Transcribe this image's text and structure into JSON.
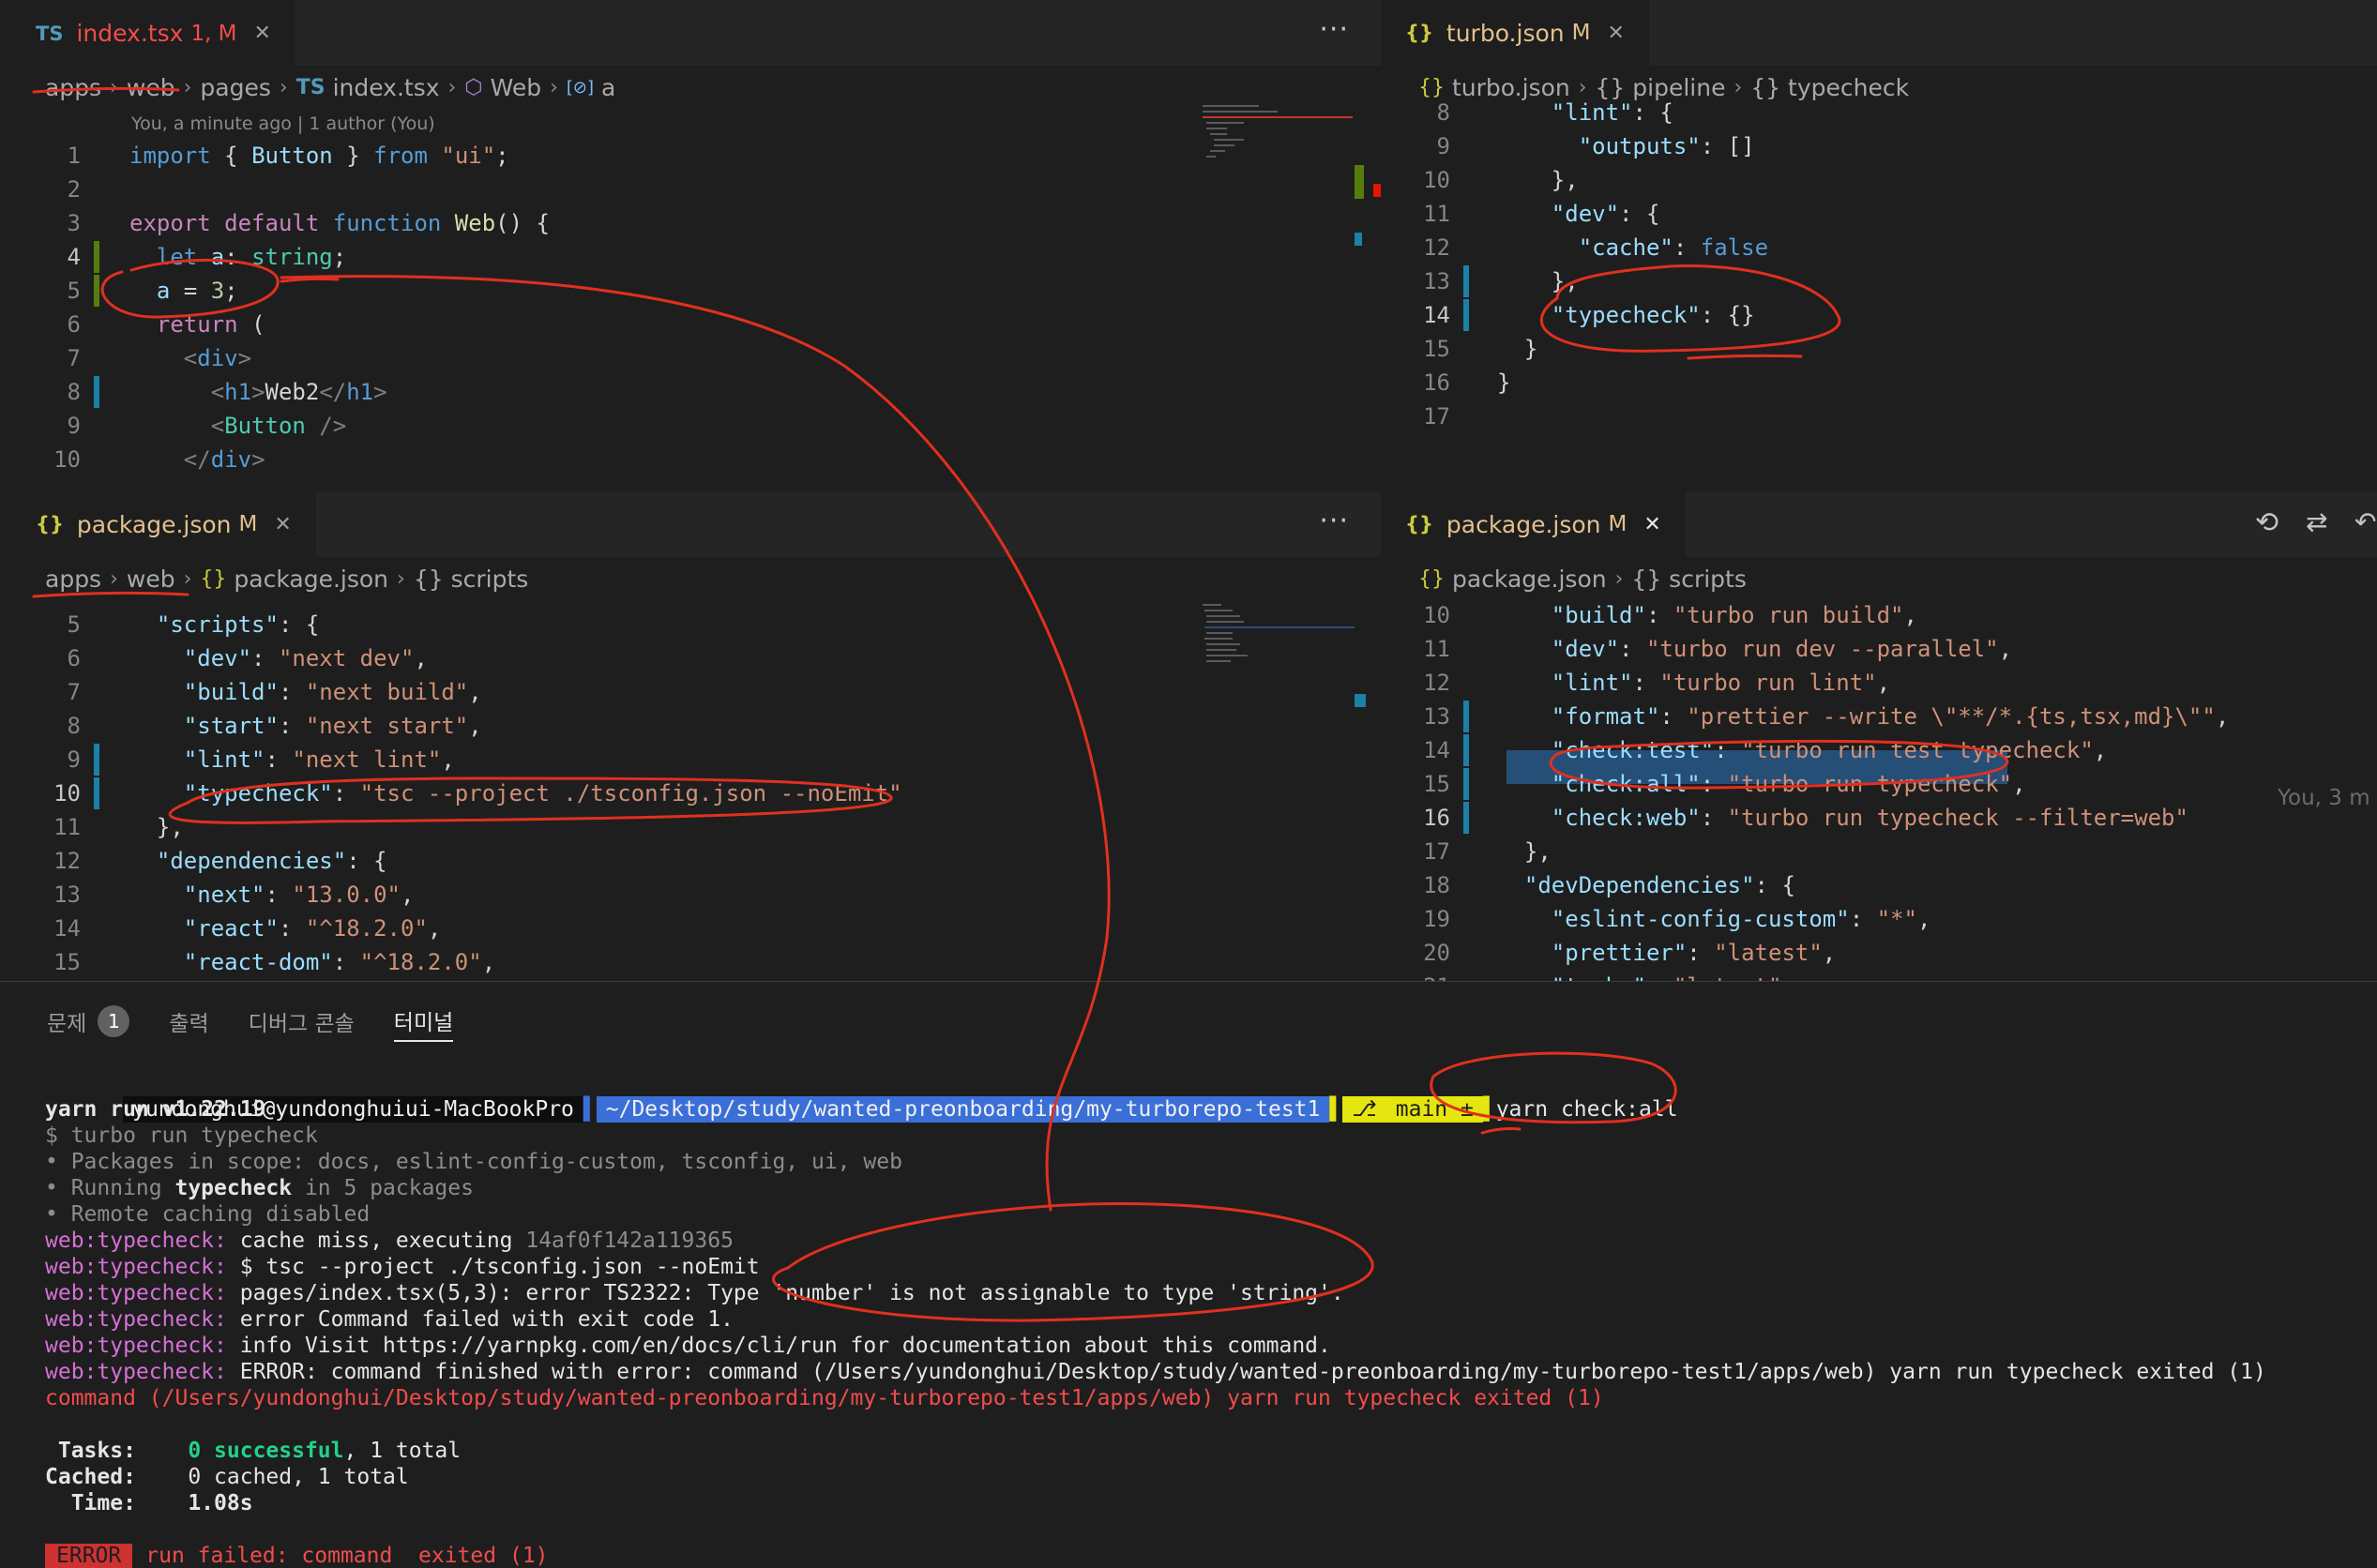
{
  "pane_tl": {
    "tab": {
      "icon": "TS",
      "name": "index.tsx",
      "status": "1, M",
      "close": "✕"
    },
    "more": "···",
    "breadcrumb": [
      "apps",
      "web",
      "pages",
      "index.tsx",
      "Web",
      "a"
    ],
    "breadcrumb_icons": {
      "file": "TS",
      "func": "⬡",
      "var": "[⊘]"
    },
    "blame": "You, a minute ago | 1 author (You)",
    "lines": [
      {
        "n": "1",
        "t": [
          [
            "kb",
            "import "
          ],
          [
            "w",
            "{ "
          ],
          [
            "p",
            "Button"
          ],
          [
            "w",
            " } "
          ],
          [
            "kb",
            "from "
          ],
          [
            "s",
            "\"ui\""
          ],
          [
            "w",
            ";"
          ]
        ]
      },
      {
        "n": "2",
        "t": []
      },
      {
        "n": "3",
        "t": [
          [
            "k",
            "export "
          ],
          [
            "k",
            "default "
          ],
          [
            "kb",
            "function "
          ],
          [
            "f",
            "Web"
          ],
          [
            "w",
            "() {"
          ]
        ]
      },
      {
        "n": "4",
        "t": [
          [
            "w",
            "  "
          ],
          [
            "kb",
            "let "
          ],
          [
            "p",
            "a"
          ],
          [
            "w",
            ": "
          ],
          [
            "ty",
            "string"
          ],
          [
            "w",
            ";"
          ]
        ]
      },
      {
        "n": "5",
        "t": [
          [
            "w",
            "  "
          ],
          [
            "p",
            "a"
          ],
          [
            "w",
            " = "
          ],
          [
            "n",
            "3"
          ],
          [
            "w",
            ";"
          ]
        ]
      },
      {
        "n": "6",
        "t": [
          [
            "w",
            "  "
          ],
          [
            "k",
            "return "
          ],
          [
            "w",
            "("
          ]
        ]
      },
      {
        "n": "7",
        "t": [
          [
            "w",
            "    "
          ],
          [
            "g",
            "<"
          ],
          [
            "kb",
            "div"
          ],
          [
            "g",
            ">"
          ]
        ]
      },
      {
        "n": "8",
        "t": [
          [
            "w",
            "      "
          ],
          [
            "g",
            "<"
          ],
          [
            "kb",
            "h1"
          ],
          [
            "g",
            ">"
          ],
          [
            "w",
            "Web2"
          ],
          [
            "g",
            "</"
          ],
          [
            "kb",
            "h1"
          ],
          [
            "g",
            ">"
          ]
        ]
      },
      {
        "n": "9",
        "t": [
          [
            "w",
            "      "
          ],
          [
            "g",
            "<"
          ],
          [
            "t",
            "Button"
          ],
          [
            "w",
            " "
          ],
          [
            "g",
            "/>"
          ]
        ]
      },
      {
        "n": "10",
        "t": [
          [
            "w",
            "    "
          ],
          [
            "g",
            "</"
          ],
          [
            "kb",
            "div"
          ],
          [
            "g",
            ">"
          ]
        ]
      }
    ]
  },
  "pane_tr": {
    "tab": {
      "icon": "{}",
      "name": "turbo.json",
      "status": "M",
      "close": "✕"
    },
    "breadcrumb": [
      "turbo.json",
      "{} pipeline",
      "{} typecheck"
    ],
    "lines": [
      {
        "n": "8",
        "t": [
          [
            "w",
            "    "
          ],
          [
            "p",
            "\"lint\""
          ],
          [
            "w",
            ": {"
          ]
        ]
      },
      {
        "n": "9",
        "t": [
          [
            "w",
            "      "
          ],
          [
            "p",
            "\"outputs\""
          ],
          [
            "w",
            ": []"
          ]
        ]
      },
      {
        "n": "10",
        "t": [
          [
            "w",
            "    },"
          ]
        ]
      },
      {
        "n": "11",
        "t": [
          [
            "w",
            "    "
          ],
          [
            "p",
            "\"dev\""
          ],
          [
            "w",
            ": {"
          ]
        ]
      },
      {
        "n": "12",
        "t": [
          [
            "w",
            "      "
          ],
          [
            "p",
            "\"cache\""
          ],
          [
            "w",
            ": "
          ],
          [
            "kb",
            "false"
          ]
        ]
      },
      {
        "n": "13",
        "t": [
          [
            "w",
            "    },"
          ]
        ]
      },
      {
        "n": "14",
        "t": [
          [
            "w",
            "    "
          ],
          [
            "p",
            "\"typecheck\""
          ],
          [
            "w",
            ": {}"
          ]
        ]
      },
      {
        "n": "15",
        "t": [
          [
            "w",
            "  }"
          ]
        ]
      },
      {
        "n": "16",
        "t": [
          [
            "w",
            "}"
          ]
        ]
      },
      {
        "n": "17",
        "t": []
      }
    ]
  },
  "pane_ml": {
    "tab": {
      "icon": "{}",
      "name": "package.json",
      "status": "M",
      "close": "✕"
    },
    "more": "···",
    "breadcrumb": [
      "apps",
      "web",
      "package.json",
      "{} scripts"
    ],
    "lines": [
      {
        "n": "5",
        "t": [
          [
            "w",
            "  "
          ],
          [
            "p",
            "\"scripts\""
          ],
          [
            "w",
            ": {"
          ]
        ]
      },
      {
        "n": "6",
        "t": [
          [
            "w",
            "    "
          ],
          [
            "p",
            "\"dev\""
          ],
          [
            "w",
            ": "
          ],
          [
            "s",
            "\"next dev\""
          ],
          [
            "w",
            ","
          ]
        ]
      },
      {
        "n": "7",
        "t": [
          [
            "w",
            "    "
          ],
          [
            "p",
            "\"build\""
          ],
          [
            "w",
            ": "
          ],
          [
            "s",
            "\"next build\""
          ],
          [
            "w",
            ","
          ]
        ]
      },
      {
        "n": "8",
        "t": [
          [
            "w",
            "    "
          ],
          [
            "p",
            "\"start\""
          ],
          [
            "w",
            ": "
          ],
          [
            "s",
            "\"next start\""
          ],
          [
            "w",
            ","
          ]
        ]
      },
      {
        "n": "9",
        "t": [
          [
            "w",
            "    "
          ],
          [
            "p",
            "\"lint\""
          ],
          [
            "w",
            ": "
          ],
          [
            "s",
            "\"next lint\""
          ],
          [
            "w",
            ","
          ]
        ]
      },
      {
        "n": "10",
        "t": [
          [
            "w",
            "    "
          ],
          [
            "p",
            "\"typecheck\""
          ],
          [
            "w",
            ": "
          ],
          [
            "s",
            "\"tsc --project ./tsconfig.json --noEmit\""
          ]
        ]
      },
      {
        "n": "11",
        "t": [
          [
            "w",
            "  },"
          ]
        ]
      },
      {
        "n": "12",
        "t": [
          [
            "w",
            "  "
          ],
          [
            "p",
            "\"dependencies\""
          ],
          [
            "w",
            ": {"
          ]
        ]
      },
      {
        "n": "13",
        "t": [
          [
            "w",
            "    "
          ],
          [
            "p",
            "\"next\""
          ],
          [
            "w",
            ": "
          ],
          [
            "s",
            "\"13.0.0\""
          ],
          [
            "w",
            ","
          ]
        ]
      },
      {
        "n": "14",
        "t": [
          [
            "w",
            "    "
          ],
          [
            "p",
            "\"react\""
          ],
          [
            "w",
            ": "
          ],
          [
            "s",
            "\"^18.2.0\""
          ],
          [
            "w",
            ","
          ]
        ]
      },
      {
        "n": "15",
        "t": [
          [
            "w",
            "    "
          ],
          [
            "p",
            "\"react-dom\""
          ],
          [
            "w",
            ": "
          ],
          [
            "s",
            "\"^18.2.0\""
          ],
          [
            "w",
            ","
          ]
        ]
      }
    ]
  },
  "pane_mr": {
    "tab": {
      "icon": "{}",
      "name": "package.json",
      "status": "M",
      "close": "✕"
    },
    "breadcrumb": [
      "package.json",
      "{} scripts"
    ],
    "blame_inline": "You, 3 m",
    "lines": [
      {
        "n": "10",
        "t": [
          [
            "w",
            "    "
          ],
          [
            "p",
            "\"build\""
          ],
          [
            "w",
            ": "
          ],
          [
            "s",
            "\"turbo run build\""
          ],
          [
            "w",
            ","
          ]
        ]
      },
      {
        "n": "11",
        "t": [
          [
            "w",
            "    "
          ],
          [
            "p",
            "\"dev\""
          ],
          [
            "w",
            ": "
          ],
          [
            "s",
            "\"turbo run dev --parallel\""
          ],
          [
            "w",
            ","
          ]
        ]
      },
      {
        "n": "12",
        "t": [
          [
            "w",
            "    "
          ],
          [
            "p",
            "\"lint\""
          ],
          [
            "w",
            ": "
          ],
          [
            "s",
            "\"turbo run lint\""
          ],
          [
            "w",
            ","
          ]
        ]
      },
      {
        "n": "13",
        "t": [
          [
            "w",
            "    "
          ],
          [
            "p",
            "\"format\""
          ],
          [
            "w",
            ": "
          ],
          [
            "s",
            "\"prettier --write \\\"**/*.{ts,tsx,md}\\\"\""
          ],
          [
            "w",
            ","
          ]
        ]
      },
      {
        "n": "14",
        "t": [
          [
            "w",
            "    "
          ],
          [
            "p",
            "\"check:test\""
          ],
          [
            "w",
            ": "
          ],
          [
            "s",
            "\"turbo run test typecheck\""
          ],
          [
            "w",
            ","
          ]
        ]
      },
      {
        "n": "15",
        "t": [
          [
            "w",
            "    "
          ],
          [
            "p",
            "\"check:all\""
          ],
          [
            "w",
            ": "
          ],
          [
            "s",
            "\"turbo run typecheck\""
          ],
          [
            "w",
            ","
          ]
        ]
      },
      {
        "n": "16",
        "t": [
          [
            "w",
            "    "
          ],
          [
            "p",
            "\"check:web\""
          ],
          [
            "w",
            ": "
          ],
          [
            "s",
            "\"turbo run typecheck --filter=web\""
          ]
        ]
      },
      {
        "n": "17",
        "t": [
          [
            "w",
            "  },"
          ]
        ]
      },
      {
        "n": "18",
        "t": [
          [
            "w",
            "  "
          ],
          [
            "p",
            "\"devDependencies\""
          ],
          [
            "w",
            ": {"
          ]
        ]
      },
      {
        "n": "19",
        "t": [
          [
            "w",
            "    "
          ],
          [
            "p",
            "\"eslint-config-custom\""
          ],
          [
            "w",
            ": "
          ],
          [
            "s",
            "\"*\""
          ],
          [
            "w",
            ","
          ]
        ]
      },
      {
        "n": "20",
        "t": [
          [
            "w",
            "    "
          ],
          [
            "p",
            "\"prettier\""
          ],
          [
            "w",
            ": "
          ],
          [
            "s",
            "\"latest\""
          ],
          [
            "w",
            ","
          ]
        ]
      },
      {
        "n": "21",
        "t": [
          [
            "w",
            "    "
          ],
          [
            "p",
            "\"turbo\""
          ],
          [
            "w",
            ": "
          ],
          [
            "s",
            "\"latest\""
          ]
        ]
      }
    ]
  },
  "panel": {
    "tabs": [
      {
        "label": "문제",
        "badge": "1"
      },
      {
        "label": "출력"
      },
      {
        "label": "디버그 콘솔"
      },
      {
        "label": "터미널",
        "active": true
      }
    ],
    "prompt": {
      "user": "yundonghui@yundonghuiui-MacBookPro",
      "path": "~/Desktop/study/wanted-preonboarding/my-turborepo-test1",
      "branch": "main ±",
      "command": "yarn check:all"
    },
    "lines": [
      [
        [
          "bold",
          "yarn run v1.22.19"
        ]
      ],
      [
        [
          "dim",
          "$ turbo run typecheck"
        ]
      ],
      [
        [
          "dim",
          "• Packages in scope: docs, eslint-config-custom, tsconfig, ui, web"
        ]
      ],
      [
        [
          "dim",
          "• Running "
        ],
        [
          "bold",
          "typecheck"
        ],
        [
          "dim",
          " in 5 packages"
        ]
      ],
      [
        [
          "dim",
          "• Remote caching disabled"
        ]
      ],
      [
        [
          "mag",
          "web:typecheck: "
        ],
        [
          "plain",
          "cache miss, executing "
        ],
        [
          "dim",
          "14af0f142a119365"
        ]
      ],
      [
        [
          "mag",
          "web:typecheck: "
        ],
        [
          "plain",
          "$ tsc --project ./tsconfig.json --noEmit"
        ]
      ],
      [
        [
          "mag",
          "web:typecheck: "
        ],
        [
          "plain",
          "pages/index.tsx(5,3): error TS2322: Type 'number' is not assignable to type 'string'."
        ]
      ],
      [
        [
          "mag",
          "web:typecheck: "
        ],
        [
          "plain",
          "error Command failed with exit code 1."
        ]
      ],
      [
        [
          "mag",
          "web:typecheck: "
        ],
        [
          "plain",
          "info Visit https://yarnpkg.com/en/docs/cli/run for documentation about this command."
        ]
      ],
      [
        [
          "mag",
          "web:typecheck: "
        ],
        [
          "plain",
          "ERROR: command finished with error: command (/Users/yundonghui/Desktop/study/wanted-preonboarding/my-turborepo-test1/apps/web) yarn run typecheck exited (1)"
        ]
      ],
      [
        [
          "red",
          "command (/Users/yundonghui/Desktop/study/wanted-preonboarding/my-turborepo-test1/apps/web) yarn run typecheck exited (1)"
        ]
      ],
      [],
      [
        [
          "bold",
          " Tasks:    "
        ],
        [
          "grn",
          "0 successful"
        ],
        [
          "plain",
          ", 1 total"
        ]
      ],
      [
        [
          "bold",
          "Cached:    "
        ],
        [
          "plain",
          "0 cached, 1 total"
        ]
      ],
      [
        [
          "bold",
          "  Time:    "
        ],
        [
          "bold",
          "1.08s"
        ]
      ],
      [],
      [
        [
          "errbadge",
          "ERROR"
        ],
        [
          "red",
          "run failed: command  exited (1)"
        ]
      ]
    ]
  },
  "colors": {
    "editor_bg": "#1e1e1e",
    "tabbar_bg": "#252526",
    "annotation": "#e0301e",
    "selection": "#264f78",
    "modified_tab": "#e2c08d"
  }
}
